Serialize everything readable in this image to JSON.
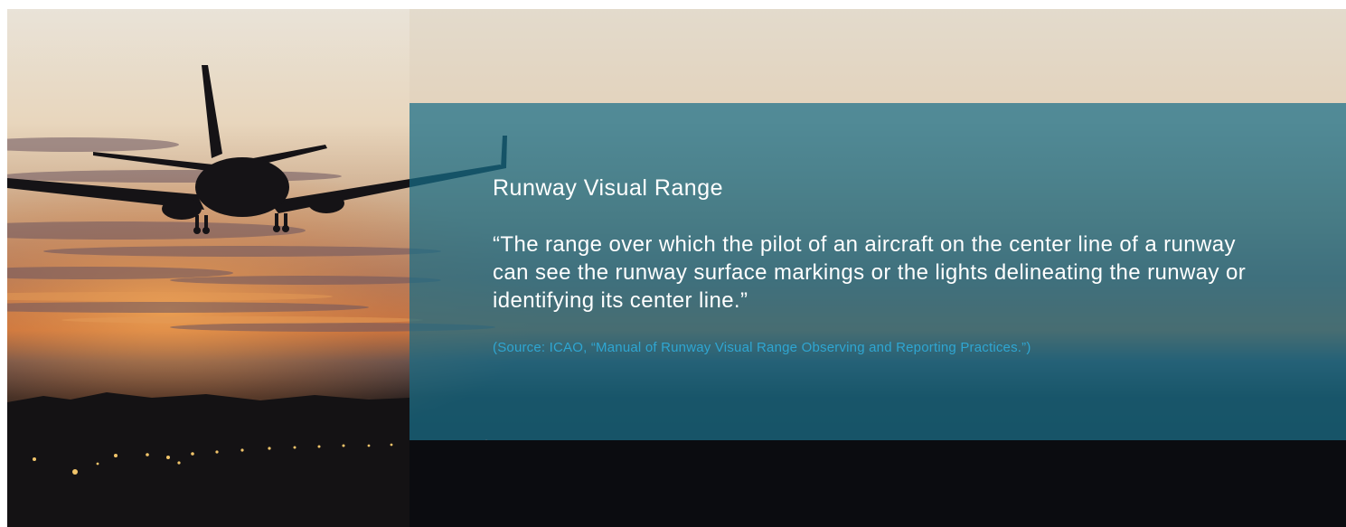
{
  "hero": {
    "image_alt": "Airplane landing at sunset over runway lights",
    "panel": {
      "title": "Runway Visual Range",
      "quote": "“The range over which the pilot of an aircraft on the center line of a runway can see the runway surface markings or the lights delineating the runway or identifying its center line.”",
      "source": "(Source: ICAO, “Manual of Runway Visual Range Observing and Reporting Practices.”)"
    }
  },
  "colors": {
    "panel_overlay": "#166c86",
    "title_text": "#ffffff",
    "source_text": "#2fa6d2"
  }
}
